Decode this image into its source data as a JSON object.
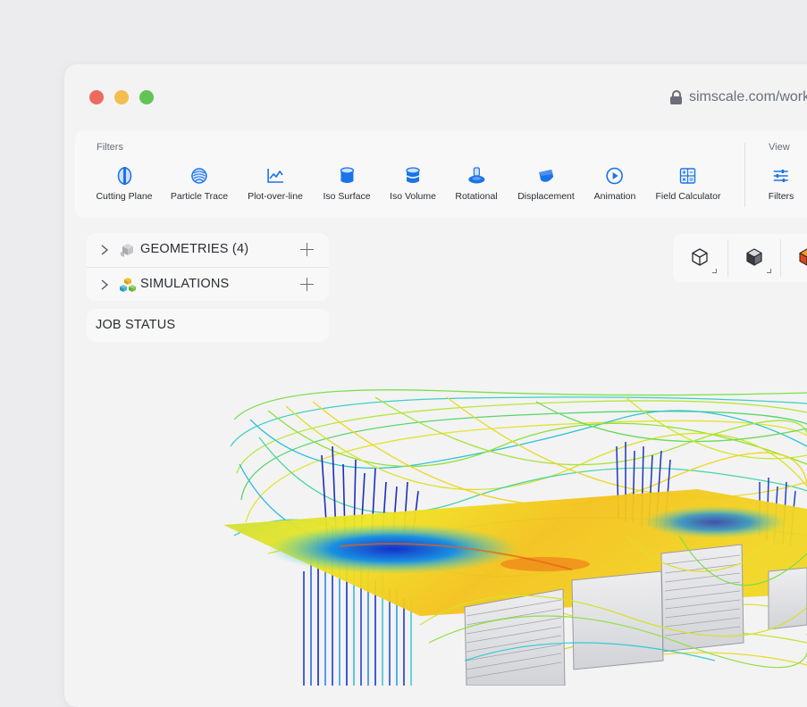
{
  "browser": {
    "url": "simscale.com/work"
  },
  "toolbar": {
    "filters_group_label": "Filters",
    "view_group_label": "View",
    "tools": [
      {
        "label": "Cutting Plane",
        "icon": "cutting-plane-icon"
      },
      {
        "label": "Particle Trace",
        "icon": "particle-trace-icon"
      },
      {
        "label": "Plot-over-line",
        "icon": "plot-over-line-icon"
      },
      {
        "label": "Iso Surface",
        "icon": "iso-surface-icon"
      },
      {
        "label": "Iso Volume",
        "icon": "iso-volume-icon"
      },
      {
        "label": "Rotational",
        "icon": "rotational-icon"
      },
      {
        "label": "Displacement",
        "icon": "displacement-icon"
      },
      {
        "label": "Animation",
        "icon": "animation-icon"
      },
      {
        "label": "Field Calculator",
        "icon": "field-calculator-icon"
      }
    ],
    "view_tools": [
      {
        "label": "Filters",
        "icon": "filters-sliders-icon"
      }
    ]
  },
  "tree": {
    "geometries_label": "GEOMETRIES",
    "geometries_count": "(4)",
    "simulations_label": "SIMULATIONS"
  },
  "job_status": {
    "label": "JOB STATUS"
  },
  "view_controls": [
    {
      "icon": "wireframe-cube-icon"
    },
    {
      "icon": "solid-cube-icon"
    },
    {
      "icon": "colored-cube-icon"
    }
  ],
  "colors": {
    "accent": "#1a73e8",
    "traffic_red": "#ed6a5e",
    "traffic_yellow": "#f3bd4f",
    "traffic_green": "#61c454"
  }
}
